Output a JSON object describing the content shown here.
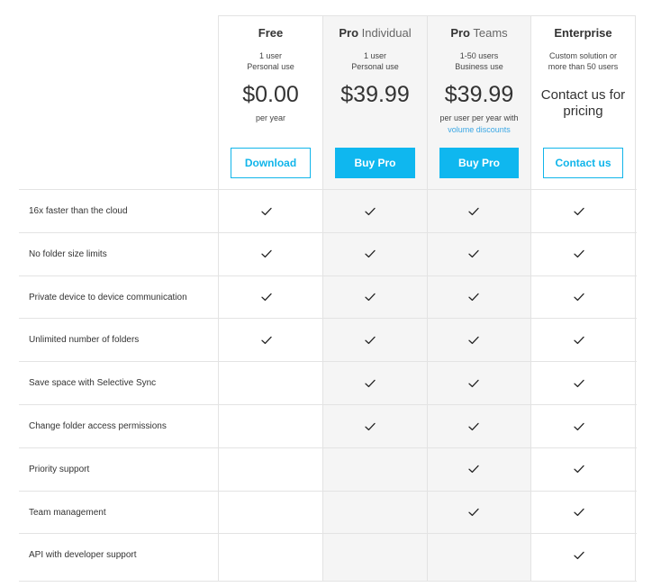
{
  "plans": [
    {
      "name_bold": "Free",
      "name_light": "",
      "sub": [
        "1 user",
        "Personal use"
      ],
      "price": "$0.00",
      "price_note": "per year",
      "price_link": "",
      "contact": "",
      "button": "Download"
    },
    {
      "name_bold": "Pro",
      "name_light": "Individual",
      "sub": [
        "1 user",
        "Personal use"
      ],
      "price": "$39.99",
      "price_note": "",
      "price_link": "",
      "contact": "",
      "button": "Buy Pro"
    },
    {
      "name_bold": "Pro",
      "name_light": "Teams",
      "sub": [
        "1-50 users",
        "Business use"
      ],
      "price": "$39.99",
      "price_note": "per user per year with",
      "price_link": "volume discounts",
      "contact": "",
      "button": "Buy Pro"
    },
    {
      "name_bold": "Enterprise",
      "name_light": "",
      "sub": [
        "Custom solution or",
        "more than 50 users"
      ],
      "price": "",
      "price_note": "",
      "price_link": "",
      "contact": "Contact us for pricing",
      "button": "Contact us"
    }
  ],
  "features": [
    {
      "label": "16x faster than the cloud",
      "included": [
        true,
        true,
        true,
        true
      ]
    },
    {
      "label": "No folder size limits",
      "included": [
        true,
        true,
        true,
        true
      ]
    },
    {
      "label": "Private device to device communication",
      "included": [
        true,
        true,
        true,
        true
      ]
    },
    {
      "label": "Unlimited number of folders",
      "included": [
        true,
        true,
        true,
        true
      ]
    },
    {
      "label": "Save space with Selective Sync",
      "included": [
        false,
        true,
        true,
        true
      ]
    },
    {
      "label": "Change folder access permissions",
      "included": [
        false,
        true,
        true,
        true
      ]
    },
    {
      "label": "Priority support",
      "included": [
        false,
        false,
        true,
        true
      ]
    },
    {
      "label": "Team management",
      "included": [
        false,
        false,
        true,
        true
      ]
    },
    {
      "label": "API with developer support",
      "included": [
        false,
        false,
        false,
        true
      ]
    }
  ],
  "colors": {
    "accent": "#0fb7ef",
    "link": "#3aa7e5",
    "shade": "#f5f5f5",
    "border": "#e3e3e3"
  }
}
